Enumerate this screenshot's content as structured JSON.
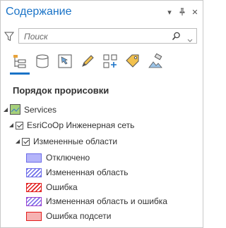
{
  "pane": {
    "title": "Содержание",
    "search_placeholder": "Поиск"
  },
  "section": {
    "heading": "Порядок прорисовки"
  },
  "tree": {
    "services": "Services",
    "network": "EsriCoOp Инженерная сеть",
    "changed_areas": "Измененные области"
  },
  "legend": [
    {
      "label": "Отключено",
      "style": "disabled"
    },
    {
      "label": "Измененная область",
      "style": "changed"
    },
    {
      "label": "Ошибка",
      "style": "error"
    },
    {
      "label": "Измененная область и ошибка",
      "style": "both"
    },
    {
      "label": "Ошибка подсети",
      "style": "subnet"
    }
  ],
  "toolbar_icons": [
    "list-by-drawing-order-icon",
    "list-by-source-icon",
    "list-by-selection-icon",
    "list-by-editing-icon",
    "list-by-snapping-icon",
    "list-by-labeling-icon",
    "list-by-perspective-imagery-icon"
  ],
  "colors": {
    "accent": "#1a73c7",
    "disabled_fill": "#b4b4fa",
    "error": "#e21c1c",
    "subnet_error_fill": "#f6b2b2"
  }
}
